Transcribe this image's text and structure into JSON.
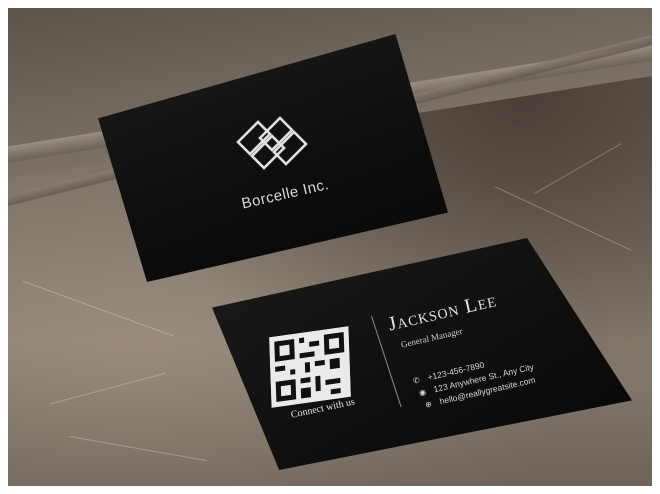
{
  "tent_card": {
    "company": "Borcelle Inc.",
    "logo": "borcelle-logo"
  },
  "business_card": {
    "name": "Jackson Lee",
    "title": "General Manager",
    "qr_caption": "Connect with us",
    "contacts": [
      {
        "icon": "phone-icon",
        "text": "+123-456-7890"
      },
      {
        "icon": "location-icon",
        "text": "123 Anywhere St., Any City"
      },
      {
        "icon": "globe-icon",
        "text": "hello@reallygreatsite.com"
      }
    ]
  },
  "colors": {
    "card": "#0e0e0e",
    "text": "#e6e6e6",
    "stone": "#7c7166"
  }
}
